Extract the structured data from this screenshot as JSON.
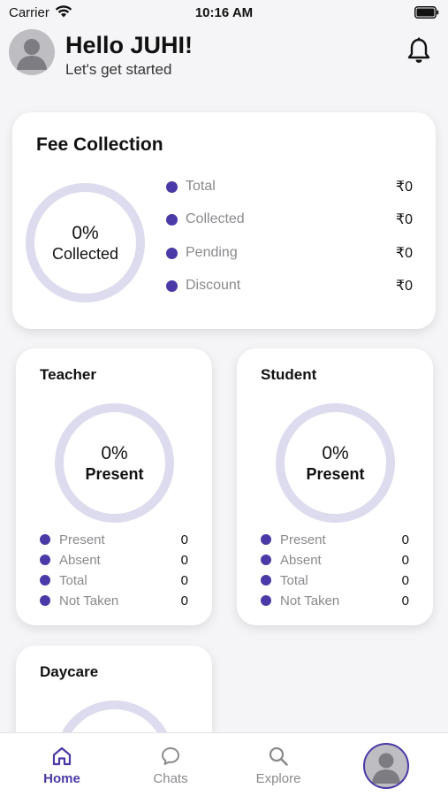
{
  "status_bar": {
    "carrier": "Carrier",
    "time": "10:16 AM"
  },
  "header": {
    "greeting": "Hello JUHI!",
    "subtitle": "Let's get started",
    "avatar_icon": "user-avatar-icon",
    "notification_icon": "bell-icon"
  },
  "fee_card": {
    "title": "Fee Collection",
    "ring": {
      "percent": "0%",
      "label": "Collected",
      "fill_fraction": 0
    },
    "items": [
      {
        "label": "Total",
        "value": "₹0"
      },
      {
        "label": "Collected",
        "value": "₹0"
      },
      {
        "label": "Pending",
        "value": "₹0"
      },
      {
        "label": "Discount",
        "value": "₹0"
      }
    ]
  },
  "teacher_card": {
    "title": "Teacher",
    "ring": {
      "percent": "0%",
      "label": "Present",
      "fill_fraction": 0
    },
    "items": [
      {
        "label": "Present",
        "value": "0"
      },
      {
        "label": "Absent",
        "value": "0"
      },
      {
        "label": "Total",
        "value": "0"
      },
      {
        "label": "Not Taken",
        "value": "0"
      }
    ]
  },
  "student_card": {
    "title": "Student",
    "ring": {
      "percent": "0%",
      "label": "Present",
      "fill_fraction": 0
    },
    "items": [
      {
        "label": "Present",
        "value": "0"
      },
      {
        "label": "Absent",
        "value": "0"
      },
      {
        "label": "Total",
        "value": "0"
      },
      {
        "label": "Not Taken",
        "value": "0"
      }
    ]
  },
  "daycare_card": {
    "title": "Daycare"
  },
  "bottom_nav": {
    "items": [
      {
        "label": "Home",
        "icon": "home-icon",
        "active": true
      },
      {
        "label": "Chats",
        "icon": "chat-bubble-icon",
        "active": false
      },
      {
        "label": "Explore",
        "icon": "search-icon",
        "active": false
      }
    ],
    "profile_icon": "profile-avatar-icon"
  },
  "colors": {
    "accent": "#4a3aa8",
    "ring_track": "#dddbee",
    "muted_text": "#8a8a8e",
    "background": "#f5f5f7"
  }
}
